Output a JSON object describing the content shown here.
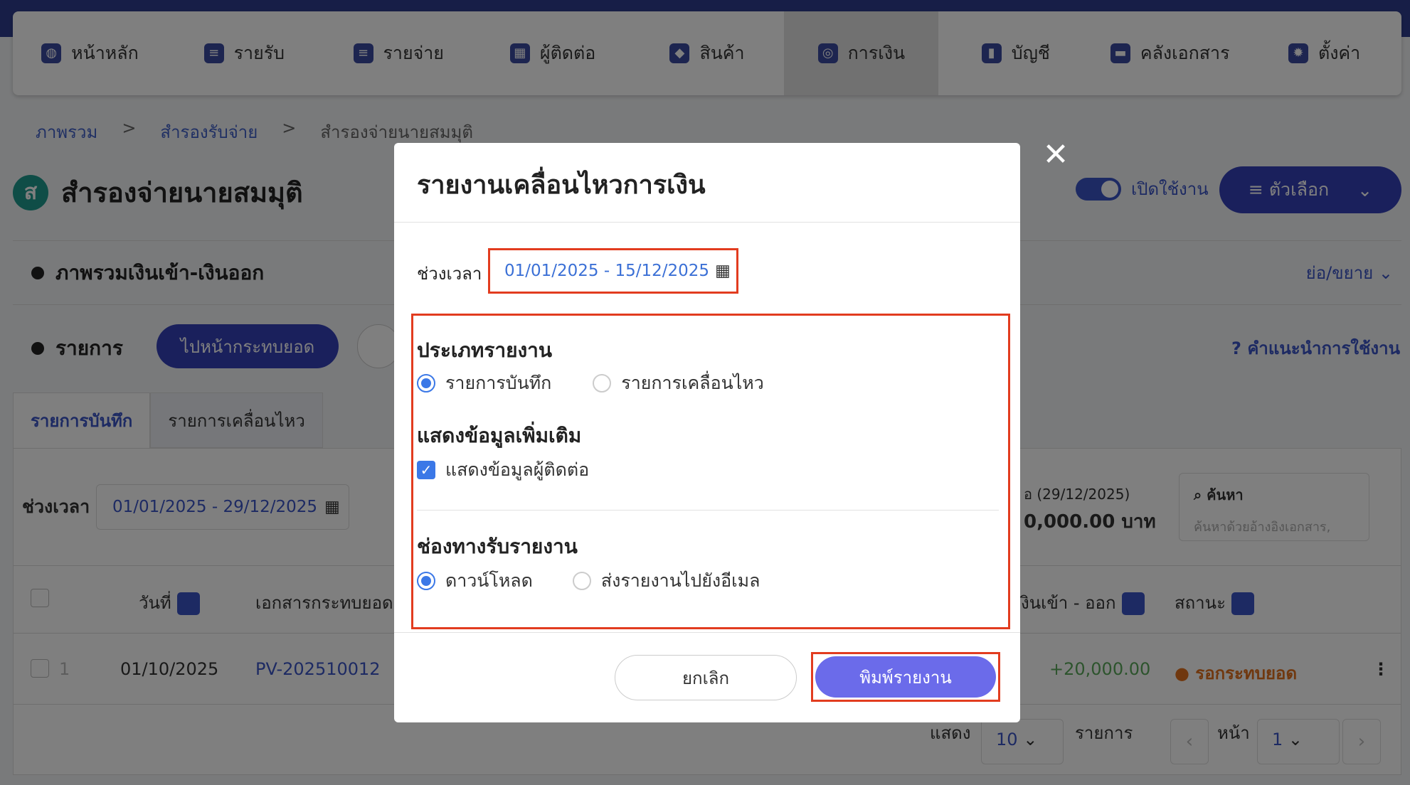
{
  "nav": {
    "items": [
      {
        "label": "หน้าหลัก",
        "icon": "dashboard-icon"
      },
      {
        "label": "รายรับ",
        "icon": "income-list-icon"
      },
      {
        "label": "รายจ่าย",
        "icon": "expense-list-icon"
      },
      {
        "label": "ผู้ติดต่อ",
        "icon": "contacts-building-icon"
      },
      {
        "label": "สินค้า",
        "icon": "box-icon"
      },
      {
        "label": "การเงิน",
        "icon": "money-icon",
        "active": true
      },
      {
        "label": "บัญชี",
        "icon": "book-icon"
      },
      {
        "label": "คลังเอกสาร",
        "icon": "folder-icon"
      },
      {
        "label": "ตั้งค่า",
        "icon": "gear-icon"
      }
    ]
  },
  "breadcrumb": {
    "items": [
      "ภาพรวม",
      "สำรองรับจ่าย",
      "สำรองจ่ายนายสมมุติ"
    ],
    "separator": ">"
  },
  "page": {
    "avatar_letter": "ส",
    "title": "สำรองจ่ายนายสมมุติ",
    "toggle_label": "เปิดใช้งาน",
    "options_label": "≡ ตัวเลือก"
  },
  "overview": {
    "title": "ภาพรวมเงินเข้า-เงินออก",
    "collapse_label": "ย่อ/ขยาย"
  },
  "list": {
    "title": "รายการ",
    "goto_button": "ไปหน้ากระทบยอด",
    "help_label": "คำแนะนำการใช้งาน",
    "tabs": [
      "รายการบันทึก",
      "รายการเคลื่อนไหว"
    ],
    "period_label": "ช่วงเวลา",
    "period_value": "01/01/2025 - 29/12/2025",
    "balance_label": "อ (29/12/2025)",
    "balance_value": "0,000.00 บาท",
    "search_title": "ค้นหา",
    "search_placeholder": "ค้นหาด้วยอ้างอิงเอกสาร,",
    "columns": {
      "date": "วันที่",
      "doc": "เอกสารกระทบยอด",
      "inout": "งินเข้า - ออก",
      "status": "สถานะ"
    },
    "rows": [
      {
        "no": "1",
        "date": "01/10/2025",
        "doc": "PV-202510012",
        "amount": "+20,000.00",
        "status": "รอกระทบยอด"
      }
    ],
    "pager": {
      "show_label": "แสดง",
      "per_page": "10",
      "items_label": "รายการ",
      "page_label": "หน้า",
      "page_value": "1"
    }
  },
  "modal": {
    "title": "รายงานเคลื่อนไหวการเงิน",
    "period_label": "ช่วงเวลา",
    "period_value": "01/01/2025 - 15/12/2025",
    "report_type_title": "ประเภทรายงาน",
    "report_type_options": [
      "รายการบันทึก",
      "รายการเคลื่อนไหว"
    ],
    "extra_title": "แสดงข้อมูลเพิ่มเติม",
    "extra_checkbox": "แสดงข้อมูลผู้ติดต่อ",
    "channel_title": "ช่องทางรับรายงาน",
    "channel_options": [
      "ดาวน์โหลด",
      "ส่งรายงานไปยังอีเมล"
    ],
    "cancel_label": "ยกเลิก",
    "print_label": "พิมพ์รายงาน"
  },
  "colors": {
    "brand": "#3540b8",
    "highlight": "#e23c1f",
    "accent_blue": "#3b78e7",
    "primary_button": "#6b6bea",
    "amount_positive": "#5aa85a",
    "status_pending": "#e0701e"
  }
}
